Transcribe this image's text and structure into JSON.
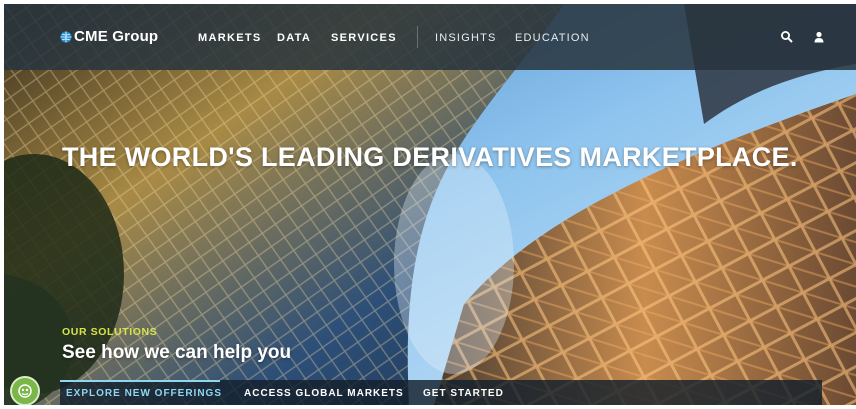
{
  "brand": {
    "name": "CME Group",
    "accent": "#1f8fd6",
    "logo_icon": "globe-icon"
  },
  "nav": {
    "items": [
      "MARKETS",
      "DATA",
      "SERVICES"
    ],
    "secondary": [
      "INSIGHTS",
      "EDUCATION"
    ],
    "icons": [
      "search-icon",
      "user-icon"
    ]
  },
  "hero": {
    "headline": "THE WORLD'S LEADING DERIVATIVES MARKETPLACE.",
    "eyebrow": "OUR SOLUTIONS",
    "subhead": "See how we can help you"
  },
  "tabs": {
    "items": [
      "EXPLORE NEW OFFERINGS",
      "ACCESS GLOBAL MARKETS",
      "GET STARTED"
    ],
    "active_index": 0,
    "active_color": "#8fd6f0"
  },
  "chat": {
    "icon": "chat-icon",
    "color": "#7ab648"
  }
}
